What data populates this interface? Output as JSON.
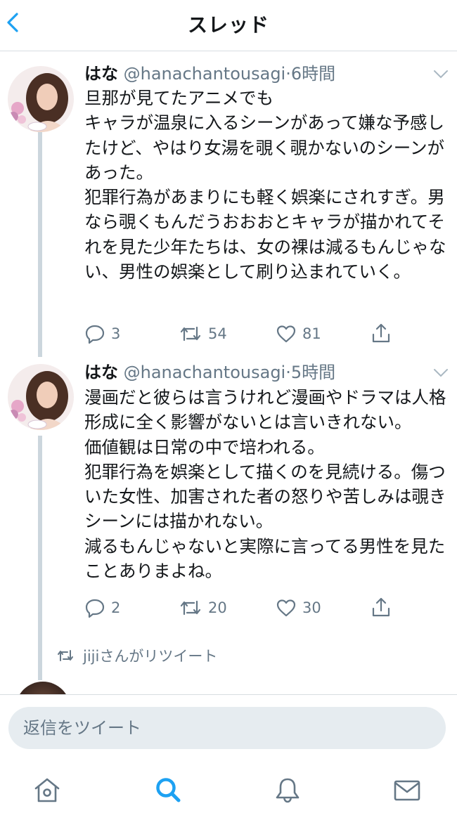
{
  "header": {
    "title": "スレッド",
    "back_icon": "chevron-left-icon",
    "accent_color": "#1da1f2"
  },
  "tweets": [
    {
      "name": "はな",
      "handle": "@hanachantousagi",
      "separator": "·",
      "time": "6時間",
      "text": "旦那が見てたアニメでも\nキャラが温泉に入るシーンがあって嫌な予感したけど、やはり女湯を覗く覗かないのシーンがあった。\n犯罪行為があまりにも軽く娯楽にされすぎ。男なら覗くもんだうおおおとキャラが描かれてそれを見た少年たちは、女の裸は減るもんじゃない、男性の娯楽として刷り込まれていく。",
      "replies": "3",
      "retweets": "54",
      "likes": "81"
    },
    {
      "name": "はな",
      "handle": "@hanachantousagi",
      "separator": "·",
      "time": "5時間",
      "text": "漫画だと彼らは言うけれど漫画やドラマは人格形成に全く影響がないとは言いきれない。\n価値観は日常の中で培われる。\n犯罪行為を娯楽として描くのを見続ける。傷ついた女性、加害された者の怒りや苦しみは覗きシーンには描かれない。\n減るもんじゃないと実際に言ってる男性を見たことありまよね。",
      "replies": "2",
      "retweets": "20",
      "likes": "30"
    }
  ],
  "retweet_notice": "jijiさんがリツイート",
  "reply": {
    "placeholder": "返信をツイート"
  },
  "tabbar": {
    "items": [
      "home-icon",
      "search-icon",
      "notifications-icon",
      "messages-icon"
    ],
    "active": "search-icon"
  }
}
